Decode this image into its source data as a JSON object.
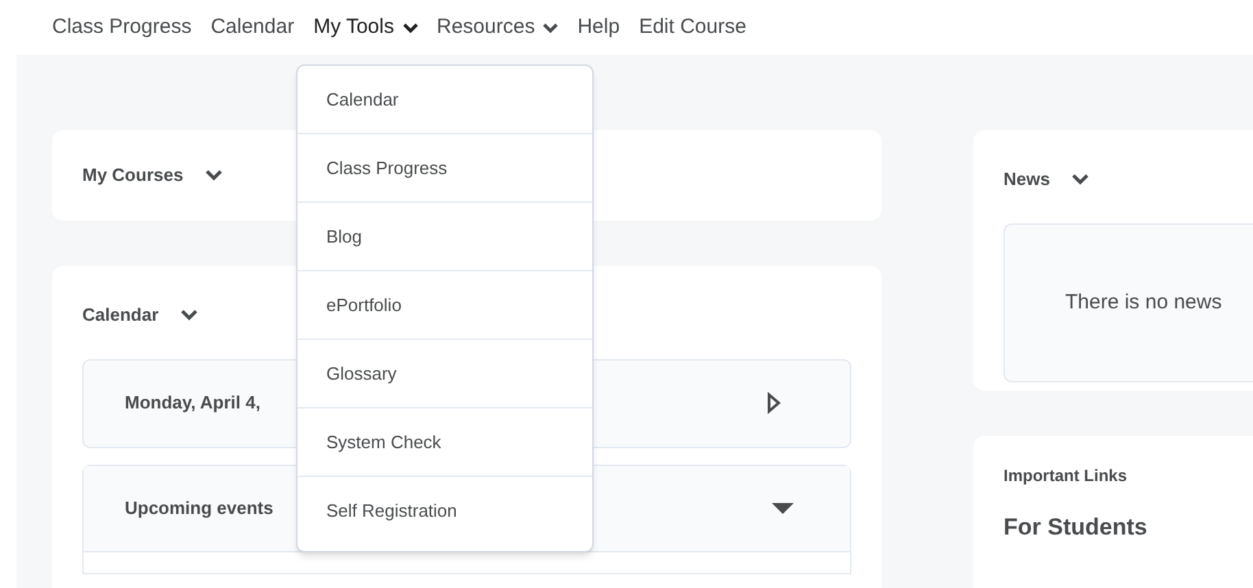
{
  "nav": [
    {
      "label": "Class Progress",
      "has_menu": false,
      "expanded": false
    },
    {
      "label": "Calendar",
      "has_menu": false,
      "expanded": false
    },
    {
      "label": "My Tools",
      "has_menu": true,
      "expanded": true
    },
    {
      "label": "Resources",
      "has_menu": true,
      "expanded": false
    },
    {
      "label": "Help",
      "has_menu": false,
      "expanded": false
    },
    {
      "label": "Edit Course",
      "has_menu": false,
      "expanded": false
    }
  ],
  "menu": {
    "items": [
      "Calendar",
      "Class Progress",
      "Blog",
      "ePortfolio",
      "Glossary",
      "System Check",
      "Self Registration"
    ]
  },
  "my_courses": {
    "title": "My Courses"
  },
  "calendar": {
    "title": "Calendar",
    "day": "Monday, April 4,",
    "upcoming": "Upcoming events"
  },
  "news": {
    "title": "News",
    "message": "There is no news"
  },
  "links": {
    "title": "Important Links",
    "heading": "For Students"
  }
}
